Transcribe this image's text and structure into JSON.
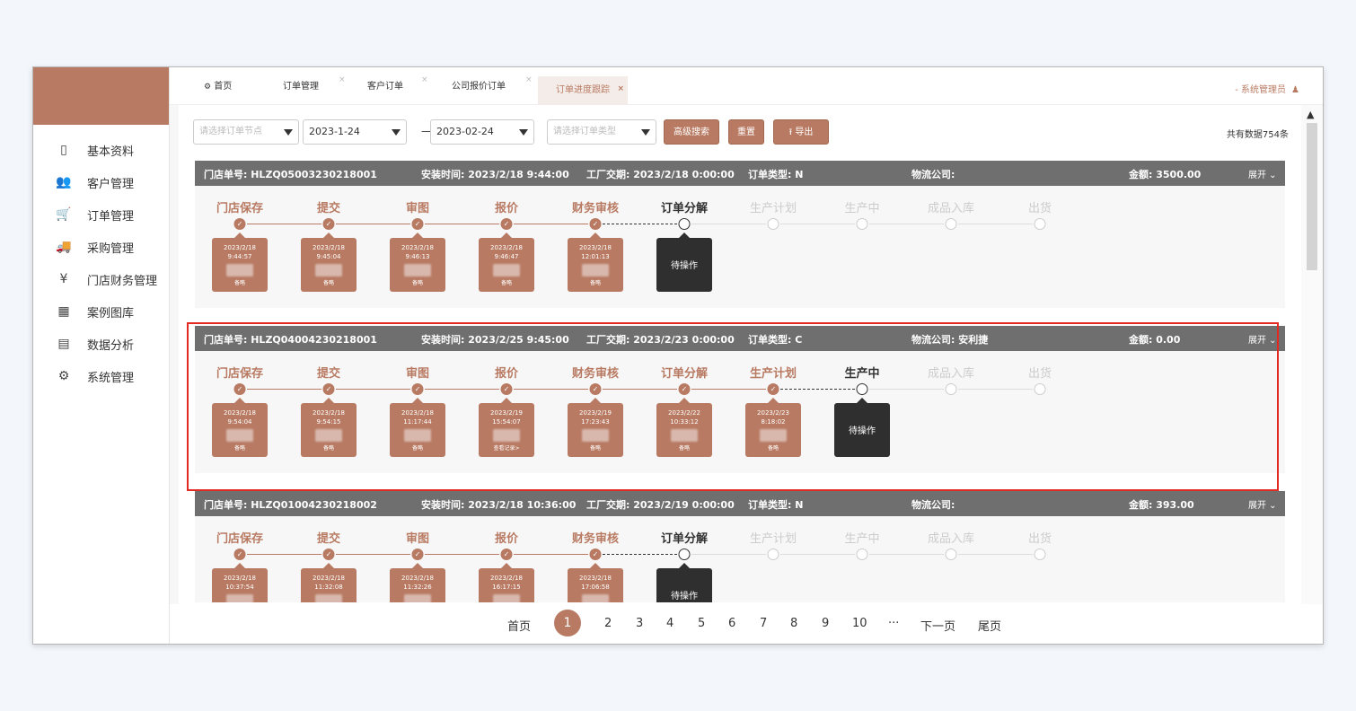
{
  "sidebar": {
    "items": [
      {
        "label": "基本资料",
        "icon": "document-icon"
      },
      {
        "label": "客户管理",
        "icon": "users-icon"
      },
      {
        "label": "订单管理",
        "icon": "cart-icon"
      },
      {
        "label": "采购管理",
        "icon": "truck-icon"
      },
      {
        "label": "门店财务管理",
        "icon": "yen-icon"
      },
      {
        "label": "案例图库",
        "icon": "grid-icon"
      },
      {
        "label": "数据分析",
        "icon": "chart-icon"
      },
      {
        "label": "系统管理",
        "icon": "gears-icon"
      }
    ]
  },
  "tabs": [
    {
      "label": "首页"
    },
    {
      "label": "订单管理",
      "close": "×"
    },
    {
      "label": "客户订单",
      "close": "×"
    },
    {
      "label": "公司报价订单",
      "close": "×"
    },
    {
      "label": "订单进度跟踪",
      "close": "×"
    }
  ],
  "user": {
    "label": "- 系统管理员"
  },
  "filters": {
    "node_placeholder": "请选择订单节点",
    "date_start": "2023-1-24",
    "dash": "—",
    "date_end": "2023-02-24",
    "type_placeholder": "请选择订单类型",
    "advanced_search": "高级搜索",
    "reset": "重置",
    "export": "导出",
    "total": "共有数据754条"
  },
  "step_names": [
    "门店保存",
    "提交",
    "审图",
    "报价",
    "财务审核",
    "订单分解",
    "生产计划",
    "生产中",
    "成品入库",
    "出货"
  ],
  "orders": [
    {
      "store_no": "门店单号: HLZQ05003230218001",
      "install_time": "安装时间: 2023/2/18 9:44:00",
      "factory_date": "工厂交期: 2023/2/18 0:00:00",
      "order_type": "订单类型: N",
      "logistics": "物流公司:",
      "amount": "金额: 3500.00",
      "expand": "展开 ⌄",
      "cards": [
        {
          "date": "2023/2/18",
          "time": "9:44:57",
          "op": "备略"
        },
        {
          "date": "2023/2/18",
          "time": "9:45:04",
          "op": "备略"
        },
        {
          "date": "2023/2/18",
          "time": "9:46:13",
          "op": "备略"
        },
        {
          "date": "2023/2/18",
          "time": "9:46:47",
          "op": "备略"
        },
        {
          "date": "2023/2/18",
          "time": "12:01:13",
          "op": "备略"
        }
      ],
      "waiting": "待操作"
    },
    {
      "store_no": "门店单号: HLZQ04004230218001",
      "install_time": "安装时间: 2023/2/25 9:45:00",
      "factory_date": "工厂交期: 2023/2/23 0:00:00",
      "order_type": "订单类型: C",
      "logistics": "物流公司: 安利捷",
      "amount": "金额: 0.00",
      "expand": "展开 ⌄",
      "cards": [
        {
          "date": "2023/2/18",
          "time": "9:54:04",
          "op": "备略"
        },
        {
          "date": "2023/2/18",
          "time": "9:54:15",
          "op": "备略"
        },
        {
          "date": "2023/2/18",
          "time": "11:17:44",
          "op": "备略"
        },
        {
          "date": "2023/2/19",
          "time": "15:54:07",
          "op": "查看记录>"
        },
        {
          "date": "2023/2/19",
          "time": "17:23:43",
          "op": "备略"
        },
        {
          "date": "2023/2/22",
          "time": "10:33:12",
          "op": "备略"
        },
        {
          "date": "2023/2/23",
          "time": "8:18:02",
          "op": "备略"
        }
      ],
      "waiting": "待操作"
    },
    {
      "store_no": "门店单号: HLZQ01004230218002",
      "install_time": "安装时间: 2023/2/18 10:36:00",
      "factory_date": "工厂交期: 2023/2/19 0:00:00",
      "order_type": "订单类型: N",
      "logistics": "物流公司:",
      "amount": "金额: 393.00",
      "expand": "展开 ⌄",
      "cards": [
        {
          "date": "2023/2/18",
          "time": "10:37:54",
          "op": ""
        },
        {
          "date": "2023/2/18",
          "time": "11:32:08",
          "op": ""
        },
        {
          "date": "2023/2/18",
          "time": "11:32:26",
          "op": ""
        },
        {
          "date": "2023/2/18",
          "time": "16:17:15",
          "op": ""
        },
        {
          "date": "2023/2/18",
          "time": "17:06:58",
          "op": ""
        }
      ],
      "waiting": "待操作"
    }
  ],
  "pager": {
    "first": "首页",
    "pages": [
      "1",
      "2",
      "3",
      "4",
      "5",
      "6",
      "7",
      "8",
      "9",
      "10"
    ],
    "ellipsis": "···",
    "next": "下一页",
    "last": "尾页"
  },
  "colors": {
    "accent": "#b87a62",
    "header_bar": "#6f6f6f",
    "highlight": "#e22a22",
    "waiting": "#2f2f2f"
  }
}
